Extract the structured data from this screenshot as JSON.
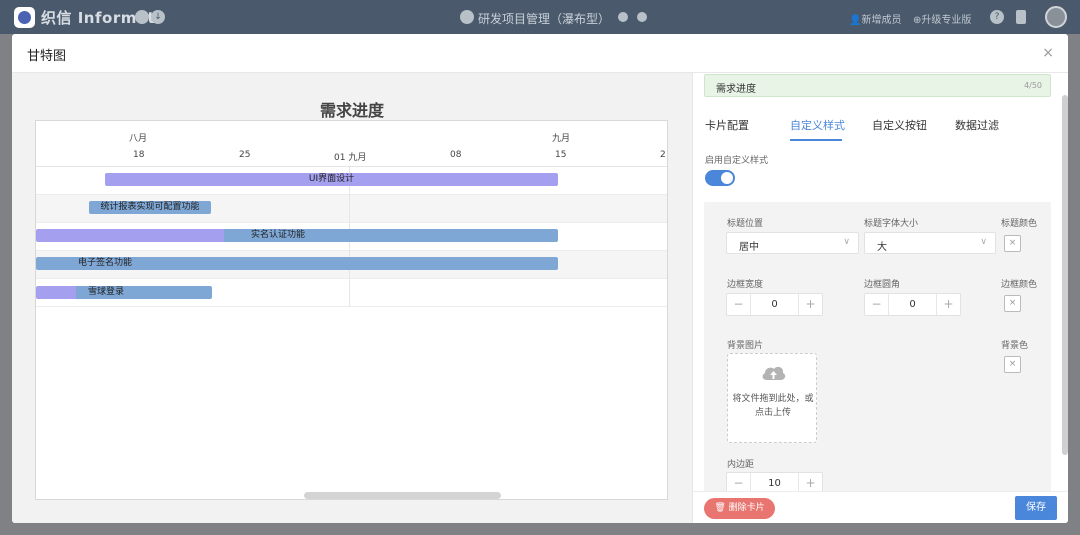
{
  "app": {
    "brand": "织信 Informat",
    "project_title": "研发项目管理（瀑布型）",
    "new_member": "新增成员",
    "upgrade": "升级专业版",
    "help_icon": "?"
  },
  "modal": {
    "title": "甘特图",
    "close": "×"
  },
  "gantt": {
    "title": "需求进度",
    "months": [
      "八月",
      "九月"
    ],
    "days": [
      "18",
      "25",
      "01 九月",
      "08",
      "15",
      "2"
    ],
    "tasks": [
      {
        "name": "UI界面设计"
      },
      {
        "name": "统计报表实现可配置功能"
      },
      {
        "name": "实名认证功能"
      },
      {
        "name": "电子签名功能"
      },
      {
        "name": "雪球登录"
      }
    ]
  },
  "panel": {
    "title_value": "需求进度",
    "title_count": "4/50",
    "tabs": [
      "卡片配置",
      "自定义样式",
      "自定义按钮",
      "数据过滤"
    ],
    "enable_label": "启用自定义样式",
    "title_position_label": "标题位置",
    "title_position_value": "居中",
    "title_font_size_label": "标题字体大小",
    "title_font_size_value": "大",
    "title_color_label": "标题颜色",
    "border_width_label": "边框宽度",
    "border_width_value": "0",
    "border_radius_label": "边框圆角",
    "border_radius_value": "0",
    "border_color_label": "边框颜色",
    "bg_image_label": "背景图片",
    "upload_hint": "将文件拖到此处，或点击上传",
    "bg_color_label": "背景色",
    "padding_label": "内边距",
    "padding_value": "10",
    "minus": "−",
    "plus": "+",
    "swatch_x": "×",
    "delete_card": "删除卡片",
    "save": "保存"
  }
}
